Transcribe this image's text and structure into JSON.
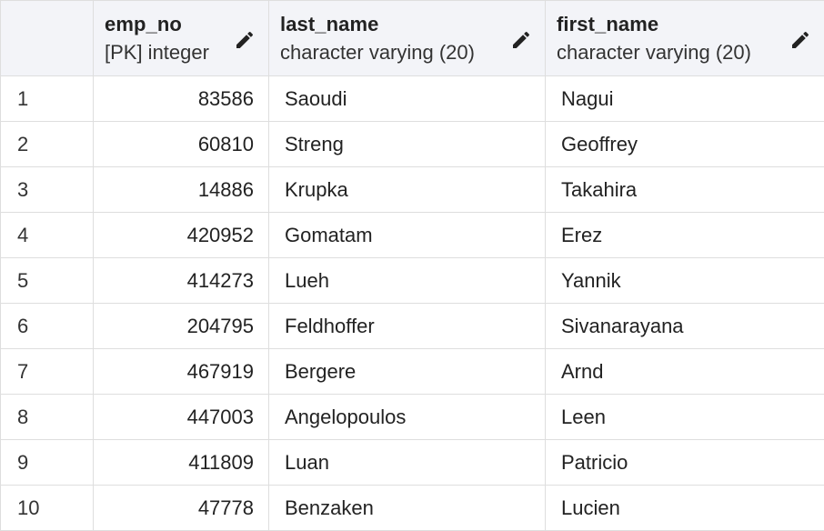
{
  "columns": [
    {
      "name": "emp_no",
      "type": "[PK] integer"
    },
    {
      "name": "last_name",
      "type": "character varying (20)"
    },
    {
      "name": "first_name",
      "type": "character varying (20)"
    }
  ],
  "icons": {
    "edit": "pencil-icon"
  },
  "rows": [
    {
      "row": "1",
      "emp_no": "83586",
      "last_name": "Saoudi",
      "first_name": "Nagui"
    },
    {
      "row": "2",
      "emp_no": "60810",
      "last_name": "Streng",
      "first_name": "Geoffrey"
    },
    {
      "row": "3",
      "emp_no": "14886",
      "last_name": "Krupka",
      "first_name": "Takahira"
    },
    {
      "row": "4",
      "emp_no": "420952",
      "last_name": "Gomatam",
      "first_name": "Erez"
    },
    {
      "row": "5",
      "emp_no": "414273",
      "last_name": "Lueh",
      "first_name": "Yannik"
    },
    {
      "row": "6",
      "emp_no": "204795",
      "last_name": "Feldhoffer",
      "first_name": "Sivanarayana"
    },
    {
      "row": "7",
      "emp_no": "467919",
      "last_name": "Bergere",
      "first_name": "Arnd"
    },
    {
      "row": "8",
      "emp_no": "447003",
      "last_name": "Angelopoulos",
      "first_name": "Leen"
    },
    {
      "row": "9",
      "emp_no": "411809",
      "last_name": "Luan",
      "first_name": "Patricio"
    },
    {
      "row": "10",
      "emp_no": "47778",
      "last_name": "Benzaken",
      "first_name": "Lucien"
    }
  ]
}
